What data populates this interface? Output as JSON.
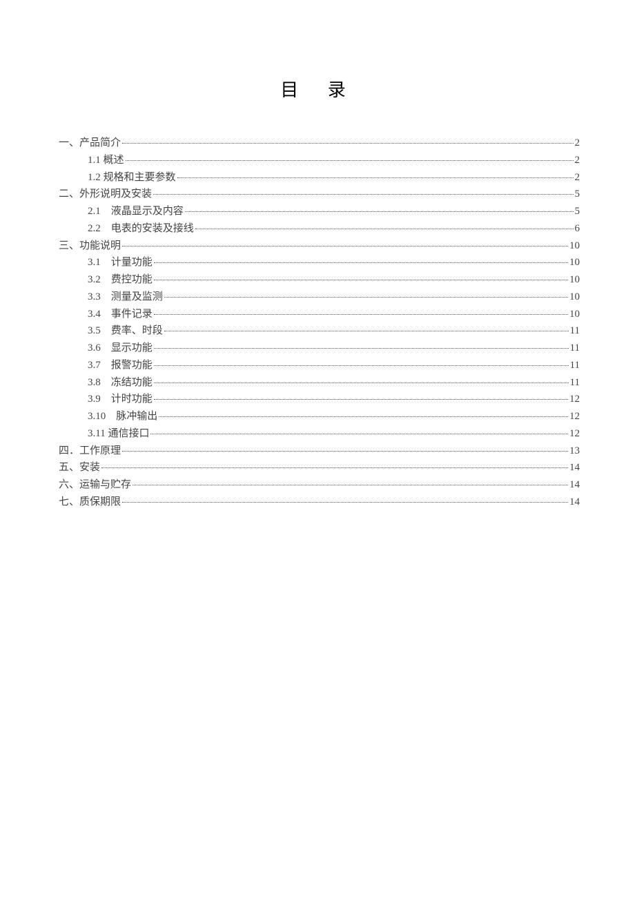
{
  "title": "目 录",
  "toc": [
    {
      "level": 0,
      "label": "一、产品简介",
      "page": "2"
    },
    {
      "level": 1,
      "label": "1.1 概述",
      "page": "2"
    },
    {
      "level": 1,
      "label": "1.2 规格和主要参数",
      "page": "2"
    },
    {
      "level": 0,
      "label": "二、外形说明及安装",
      "page": "5"
    },
    {
      "level": 1,
      "label": "2.1　液晶显示及内容",
      "page": "5"
    },
    {
      "level": 1,
      "label": "2.2　电表的安装及接线",
      "page": "6"
    },
    {
      "level": 0,
      "label": "三、功能说明",
      "page": "10"
    },
    {
      "level": 1,
      "label": "3.1　计量功能",
      "page": "10"
    },
    {
      "level": 1,
      "label": "3.2　费控功能",
      "page": "10"
    },
    {
      "level": 1,
      "label": "3.3　测量及监测",
      "page": "10"
    },
    {
      "level": 1,
      "label": "3.4　事件记录",
      "page": "10"
    },
    {
      "level": 1,
      "label": "3.5　费率、时段",
      "page": "11"
    },
    {
      "level": 1,
      "label": "3.6　显示功能",
      "page": "11"
    },
    {
      "level": 1,
      "label": "3.7　报警功能",
      "page": "11"
    },
    {
      "level": 1,
      "label": "3.8　冻结功能",
      "page": "11"
    },
    {
      "level": 1,
      "label": "3.9　计时功能",
      "page": "12"
    },
    {
      "level": 1,
      "label": "3.10　脉冲输出",
      "page": "12"
    },
    {
      "level": 1,
      "label": "3.11 通信接口",
      "page": "12"
    },
    {
      "level": 0,
      "label": "四．工作原理",
      "page": "13"
    },
    {
      "level": 0,
      "label": "五、安装",
      "page": "14"
    },
    {
      "level": 0,
      "label": "六、运输与贮存",
      "page": "14"
    },
    {
      "level": 0,
      "label": "七、质保期限",
      "page": "14"
    }
  ]
}
